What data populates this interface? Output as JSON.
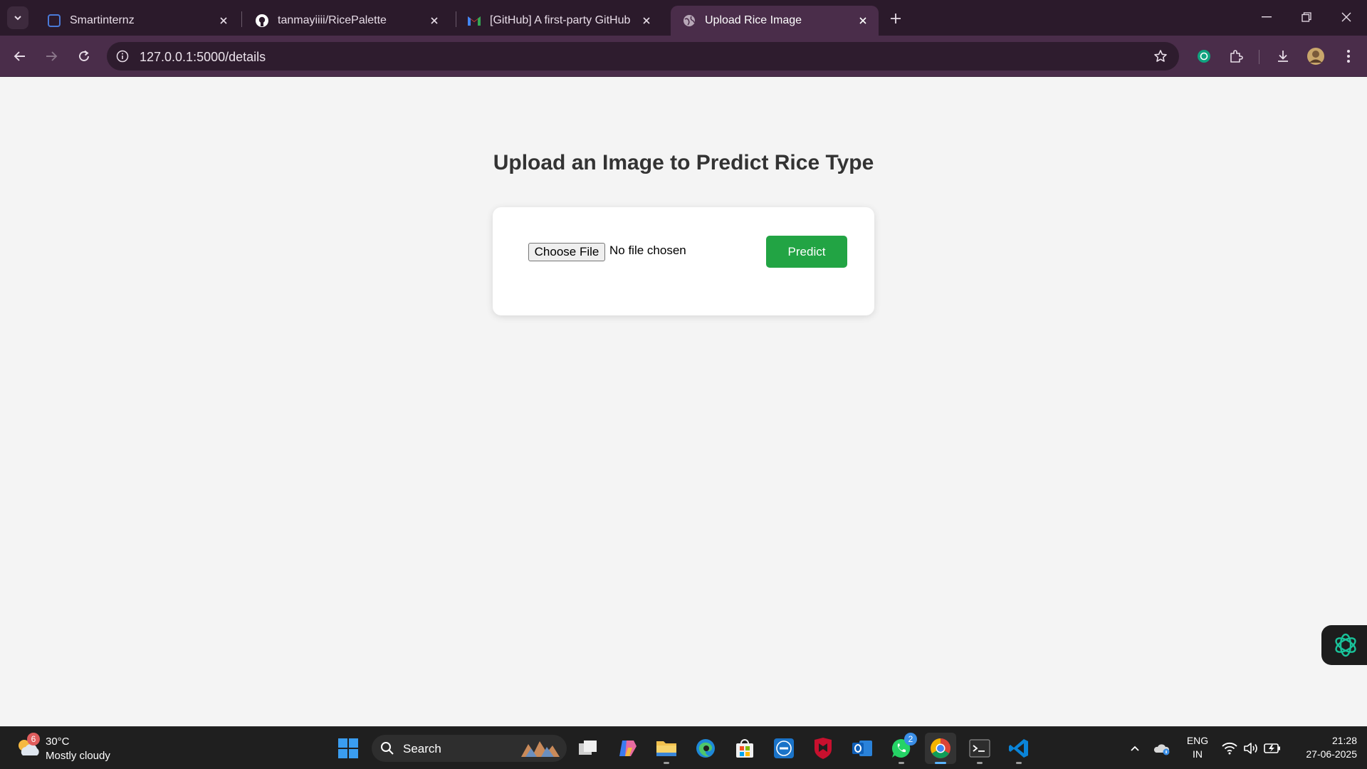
{
  "browser": {
    "tabs": [
      {
        "title": "Smartinternz",
        "icon": "smartinternz-favicon"
      },
      {
        "title": "tanmayiiii/RicePalette",
        "icon": "github-favicon"
      },
      {
        "title": "[GitHub] A first-party GitHub O",
        "icon": "gmail-favicon"
      },
      {
        "title": "Upload Rice Image",
        "icon": "globe-favicon"
      }
    ],
    "url": "127.0.0.1:5000/details",
    "theme_color": "#4a2d4a"
  },
  "page": {
    "heading": "Upload an Image to Predict Rice Type",
    "choose_file_label": "Choose File",
    "file_status": "No file chosen",
    "predict_label": "Predict",
    "predict_color": "#22a444"
  },
  "taskbar": {
    "weather": {
      "badge": "6",
      "temp": "30°C",
      "desc": "Mostly cloudy"
    },
    "search_label": "Search",
    "apps": [
      "start",
      "search",
      "task-view",
      "copilot",
      "file-explorer",
      "edge",
      "microsoft-store",
      "dell",
      "mcafee",
      "outlook",
      "whatsapp",
      "chrome",
      "terminal",
      "vscode"
    ],
    "whatsapp_badge": "2",
    "lang_line1": "ENG",
    "lang_line2": "IN",
    "time": "21:28",
    "date": "27-06-2025"
  }
}
